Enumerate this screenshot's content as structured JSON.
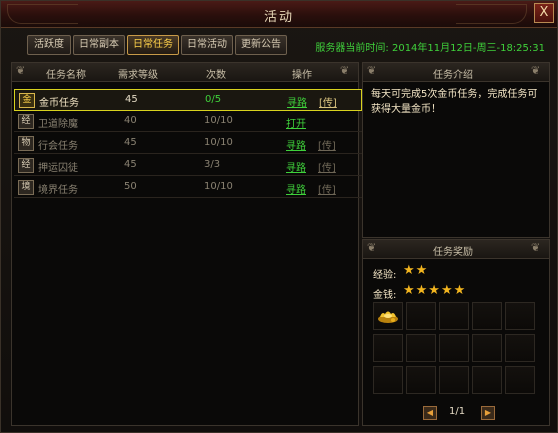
{
  "window": {
    "title": "活动",
    "close_label": "X"
  },
  "tabs": [
    {
      "label": "活跃度",
      "active": false
    },
    {
      "label": "日常副本",
      "active": false
    },
    {
      "label": "日常任务",
      "active": true
    },
    {
      "label": "日常活动",
      "active": false
    },
    {
      "label": "更新公告",
      "active": false
    }
  ],
  "server_time": "服务器当前时间: 2014年11月12日-周三-18:25:31",
  "task_table": {
    "columns": [
      "任务名称",
      "需求等级",
      "次数",
      "操作"
    ],
    "rows": [
      {
        "icon": "金",
        "name": "金币任务",
        "level": "45",
        "count": "0/5",
        "action": "寻路",
        "fly": "[传]",
        "selected": true
      },
      {
        "icon": "经",
        "name": "卫道除魔",
        "level": "40",
        "count": "10/10",
        "action": "打开",
        "fly": "",
        "selected": false
      },
      {
        "icon": "物",
        "name": "行会任务",
        "level": "45",
        "count": "10/10",
        "action": "寻路",
        "fly": "[传]",
        "selected": false
      },
      {
        "icon": "经",
        "name": "押运囚徒",
        "level": "45",
        "count": "3/3",
        "action": "寻路",
        "fly": "[传]",
        "selected": false
      },
      {
        "icon": "境",
        "name": "境界任务",
        "level": "50",
        "count": "10/10",
        "action": "寻路",
        "fly": "[传]",
        "selected": false
      }
    ]
  },
  "intro": {
    "title": "任务介绍",
    "text": "每天可完成5次金币任务，完成任务可获得大量金币！"
  },
  "rewards": {
    "title": "任务奖励",
    "exp_label": "经验:",
    "exp_stars": "★★",
    "gold_label": "金钱:",
    "gold_stars": "★★★★★",
    "item_icon": "gold-ingot-icon",
    "page": "1/1"
  },
  "colors": {
    "accent_green": "#3fd13b",
    "star_gold": "#f2b51f",
    "selected_border": "#d8d21e"
  }
}
